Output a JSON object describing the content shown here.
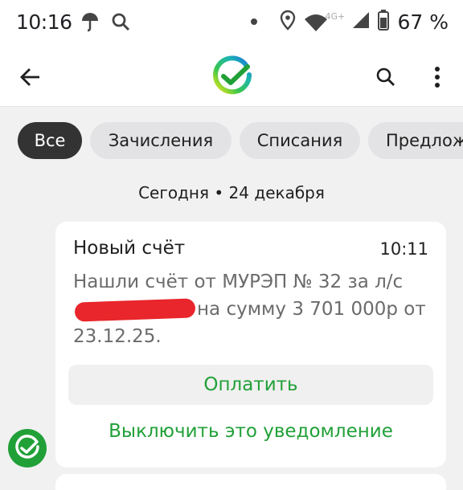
{
  "status_bar": {
    "time": "10:16",
    "network_label": "4G+",
    "battery_text": "67 %",
    "icons": [
      "umbrella-icon",
      "search-icon",
      "dot-icon",
      "location-icon",
      "wifi-icon",
      "signal-icon",
      "battery-icon"
    ]
  },
  "app_bar": {
    "icons": [
      "back-arrow-icon",
      "sber-logo-icon",
      "search-icon",
      "more-vert-icon"
    ]
  },
  "filters": {
    "chips": [
      {
        "label": "Все",
        "active": true
      },
      {
        "label": "Зачисления",
        "active": false
      },
      {
        "label": "Списания",
        "active": false
      },
      {
        "label": "Предлож",
        "active": false
      }
    ]
  },
  "feed": {
    "date_header": "Сегодня • 24 декабря",
    "card": {
      "title": "Новый счёт",
      "time": "10:11",
      "body_part1": "Нашли счёт от МУРЭП № 32 за л/с",
      "body_part2": "на сумму 3 701 000р от 23.12.25.",
      "pay_label": "Оплатить",
      "disable_label": "Выключить это уведомление"
    }
  },
  "colors": {
    "accent_green": "#21a038",
    "chip_active_bg": "#333333",
    "chip_bg": "#e3e3e5",
    "background": "#f1f1f1",
    "redaction": "#e8262b"
  }
}
